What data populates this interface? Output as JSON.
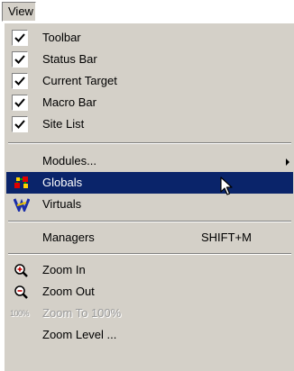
{
  "menubar": {
    "title": "View"
  },
  "menu": {
    "items": [
      {
        "label": "Toolbar",
        "checked": true
      },
      {
        "label": "Status Bar",
        "checked": true
      },
      {
        "label": "Current Target",
        "checked": true
      },
      {
        "label": "Macro Bar",
        "checked": true
      },
      {
        "label": "Site List",
        "checked": true
      },
      {
        "label": "Modules...",
        "submenu": true
      },
      {
        "label": "Globals",
        "icon": "globals-icon",
        "highlighted": true
      },
      {
        "label": "Virtuals",
        "icon": "virtuals-icon"
      },
      {
        "label": "Managers",
        "shortcut": "SHIFT+M"
      },
      {
        "label": "Zoom In",
        "icon": "zoom-in-icon"
      },
      {
        "label": "Zoom Out",
        "icon": "zoom-out-icon"
      },
      {
        "label": "Zoom To 100%",
        "icon": "zoom-100-icon",
        "disabled": true,
        "icon_text": "100%"
      },
      {
        "label": "Zoom Level ..."
      }
    ]
  },
  "colors": {
    "menu_bg": "#d4d0c8",
    "highlight_bg": "#0a246a",
    "highlight_text": "#ffffff",
    "disabled_text": "#9a9a9a"
  }
}
